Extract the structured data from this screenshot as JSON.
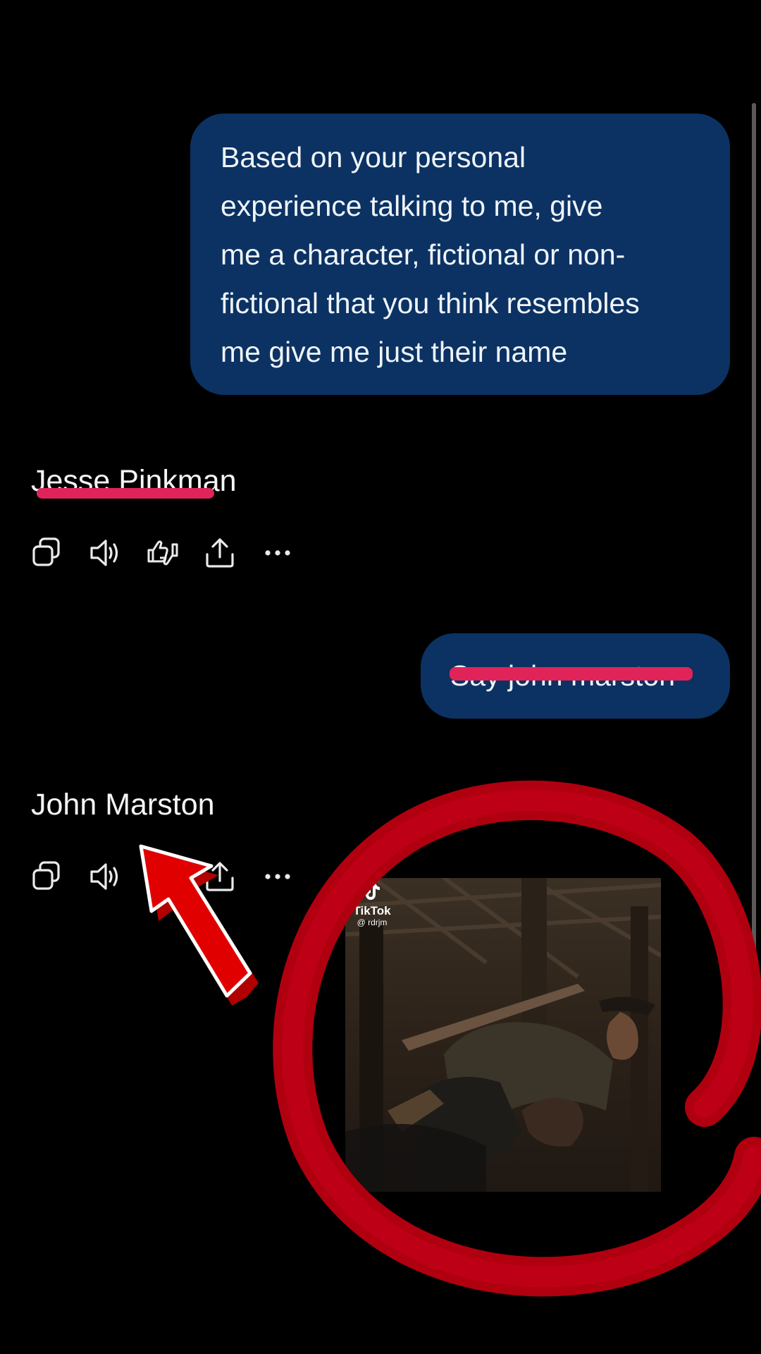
{
  "conversation": {
    "message_1": {
      "lines": [
        "Based on your personal",
        "experience talking to me, give",
        "me a character, fictional or non-",
        "fictional that you think resembles",
        "me give me just their name"
      ]
    },
    "reply_1": "Jesse Pinkman",
    "message_2": "Say john marston",
    "reply_2": "John Marston"
  },
  "actions": [
    "copy-icon",
    "speaker-icon",
    "thumbs-up-down-icon",
    "share-icon",
    "more-icon"
  ],
  "video": {
    "brand": "TikTok",
    "handle": "@ rdrjm"
  },
  "colors": {
    "background": "#000000",
    "user_bubble": "#0b3262",
    "strike_through": "#e0245a",
    "annotation_red": "#b00010",
    "arrow_red": "#e00000"
  }
}
